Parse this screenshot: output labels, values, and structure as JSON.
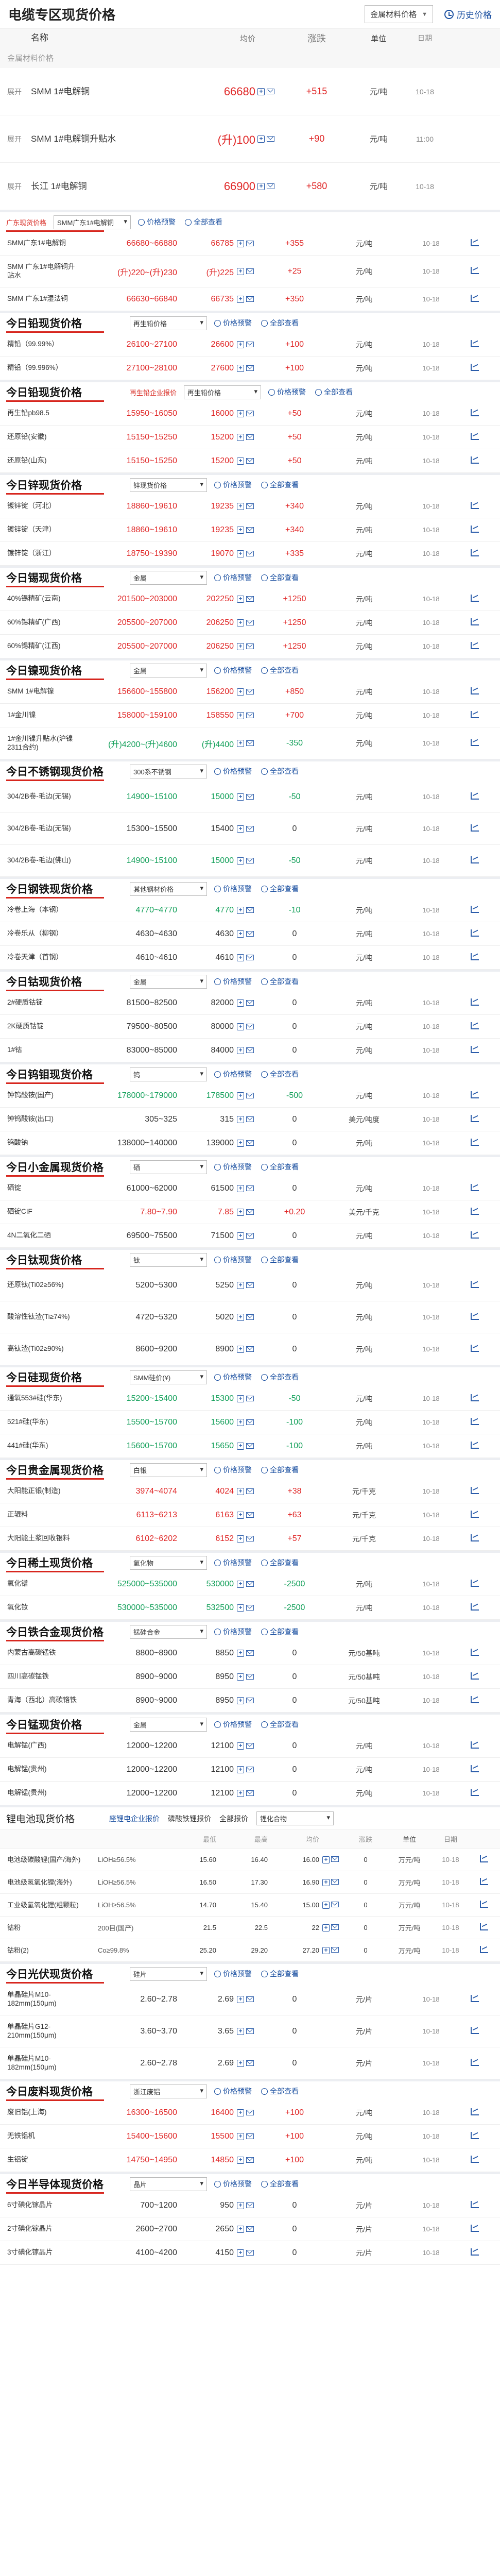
{
  "header": {
    "title": "电缆专区现货价格",
    "select_value": "金属材料价格",
    "history_label": "历史价格"
  },
  "columns": {
    "name": "名称",
    "avg": "均价",
    "chg": "涨跌",
    "unit": "单位",
    "date": "日期"
  },
  "group_label": "金属材料价格",
  "expand_label": "展开",
  "top_rows": [
    {
      "name": "SMM 1#电解铜",
      "avg": "66680",
      "chg": "+515",
      "unit": "元/吨",
      "date": "10-18",
      "dir": "up"
    },
    {
      "name": "SMM 1#电解铜升贴水",
      "avg": "(升)100",
      "chg": "+90",
      "unit": "元/吨",
      "date": "11:00",
      "dir": "up"
    },
    {
      "name": "长江 1#电解铜",
      "avg": "66900",
      "chg": "+580",
      "unit": "元/吨",
      "date": "10-18",
      "dir": "up"
    }
  ],
  "sections": [
    {
      "key": "copper",
      "title": "",
      "rows": [
        {
          "name": "SMM广东1#电解铜",
          "range": "66680~66880",
          "avg": "66785",
          "chg": "+355",
          "unit": "元/吨",
          "date": "10-18",
          "dir": "up"
        },
        {
          "name": "SMM 广东1#电解铜升贴水",
          "range": "(升)220~(升)230",
          "avg": "(升)225",
          "chg": "+25",
          "unit": "元/吨",
          "date": "10-18",
          "dir": "up"
        },
        {
          "name": "SMM 广东1#湿法铜",
          "range": "66630~66840",
          "avg": "66735",
          "chg": "+350",
          "unit": "元/吨",
          "date": "10-18",
          "dir": "up"
        }
      ],
      "tag": "SMM广东1#电解铜",
      "highlight": "广东现货价格"
    },
    {
      "key": "lead",
      "title": "今日铅现货价格",
      "select": "再生铅价格",
      "rows": [
        {
          "name": "精铅（99.99%）",
          "range": "26100~27100",
          "avg": "26600",
          "chg": "+100",
          "unit": "元/吨",
          "date": "10-18",
          "dir": "up"
        },
        {
          "name": "精铅（99.996%）",
          "range": "27100~28100",
          "avg": "27600",
          "chg": "+100",
          "unit": "元/吨",
          "date": "10-18",
          "dir": "up"
        }
      ]
    },
    {
      "key": "recycled-lead",
      "title": "今日铅现货价格",
      "select": "再生铅价格",
      "highlight": "再生铅企业报价",
      "rows": [
        {
          "name": "再生铅pb98.5",
          "range": "15950~16050",
          "avg": "16000",
          "chg": "+50",
          "unit": "元/吨",
          "date": "10-18",
          "dir": "up"
        },
        {
          "name": "还原铅(安徽)",
          "range": "15150~15250",
          "avg": "15200",
          "chg": "+50",
          "unit": "元/吨",
          "date": "10-18",
          "dir": "up"
        },
        {
          "name": "还原铅(山东)",
          "range": "15150~15250",
          "avg": "15200",
          "chg": "+50",
          "unit": "元/吨",
          "date": "10-18",
          "dir": "up"
        }
      ]
    },
    {
      "key": "zinc",
      "title": "今日锌现货价格",
      "select": "锌现货价格",
      "rows": [
        {
          "name": "镀锌锭（河北）",
          "range": "18860~19610",
          "avg": "19235",
          "chg": "+340",
          "unit": "元/吨",
          "date": "10-18",
          "dir": "up"
        },
        {
          "name": "镀锌锭（天津）",
          "range": "18860~19610",
          "avg": "19235",
          "chg": "+340",
          "unit": "元/吨",
          "date": "10-18",
          "dir": "up"
        },
        {
          "name": "镀锌锭（浙江）",
          "range": "18750~19390",
          "avg": "19070",
          "chg": "+335",
          "unit": "元/吨",
          "date": "10-18",
          "dir": "up"
        }
      ]
    },
    {
      "key": "tin",
      "title": "今日锡现货价格",
      "select": "金属",
      "rows": [
        {
          "name": "40%锡精矿(云南)",
          "range": "201500~203000",
          "avg": "202250",
          "chg": "+1250",
          "unit": "元/吨",
          "date": "10-18",
          "dir": "up"
        },
        {
          "name": "60%锡精矿(广西)",
          "range": "205500~207000",
          "avg": "206250",
          "chg": "+1250",
          "unit": "元/吨",
          "date": "10-18",
          "dir": "up"
        },
        {
          "name": "60%锡精矿(江西)",
          "range": "205500~207000",
          "avg": "206250",
          "chg": "+1250",
          "unit": "元/吨",
          "date": "10-18",
          "dir": "up"
        }
      ]
    },
    {
      "key": "nickel",
      "title": "今日镍现货价格",
      "select": "金属",
      "rows": [
        {
          "name": "SMM 1#电解镍",
          "range": "156600~155800",
          "avg": "156200",
          "chg": "+850",
          "unit": "元/吨",
          "date": "10-18",
          "dir": "up"
        },
        {
          "name": "1#金川镍",
          "range": "158000~159100",
          "avg": "158550",
          "chg": "+700",
          "unit": "元/吨",
          "date": "10-18",
          "dir": "up"
        },
        {
          "name": "1#金川镍升贴水(沪镍2311合约)",
          "range": "(升)4200~(升)4600",
          "avg": "(升)4400",
          "chg": "-350",
          "unit": "元/吨",
          "date": "10-18",
          "dir": "down"
        }
      ]
    },
    {
      "key": "stainless",
      "title": "今日不锈钢现货价格",
      "select": "300系不锈钢",
      "rows": [
        {
          "name": "304/2B卷-毛边(无锡)",
          "range": "14900~15100",
          "avg": "15000",
          "chg": "-50",
          "unit": "元/吨",
          "date": "10-18",
          "dir": "down"
        },
        {
          "name": "304/2B卷-毛边(无锡)",
          "range": "15300~15500",
          "avg": "15400",
          "chg": "0",
          "unit": "元/吨",
          "date": "10-18",
          "dir": "flat"
        },
        {
          "name": "304/2B卷-毛边(佛山)",
          "range": "14900~15100",
          "avg": "15000",
          "chg": "-50",
          "unit": "元/吨",
          "date": "10-18",
          "dir": "down"
        }
      ]
    },
    {
      "key": "steel",
      "title": "今日钢铁现货价格",
      "select": "其他钢材价格",
      "rows": [
        {
          "name": "冷卷上海（本钢）",
          "range": "4770~4770",
          "avg": "4770",
          "chg": "-10",
          "unit": "元/吨",
          "date": "10-18",
          "dir": "down"
        },
        {
          "name": "冷卷乐从（柳钢）",
          "range": "4630~4630",
          "avg": "4630",
          "chg": "0",
          "unit": "元/吨",
          "date": "10-18",
          "dir": "flat"
        },
        {
          "name": "冷卷天津（首钢）",
          "range": "4610~4610",
          "avg": "4610",
          "chg": "0",
          "unit": "元/吨",
          "date": "10-18",
          "dir": "flat"
        }
      ]
    },
    {
      "key": "cobalt",
      "title": "今日钴现货价格",
      "select": "金属",
      "rows": [
        {
          "name": "2#硬质钴锭",
          "range": "81500~82500",
          "avg": "82000",
          "chg": "0",
          "unit": "元/吨",
          "date": "10-18",
          "dir": "flat"
        },
        {
          "name": "2K硬质钴锭",
          "range": "79500~80500",
          "avg": "80000",
          "chg": "0",
          "unit": "元/吨",
          "date": "10-18",
          "dir": "flat"
        },
        {
          "name": "1#钴",
          "range": "83000~85000",
          "avg": "84000",
          "chg": "0",
          "unit": "元/吨",
          "date": "10-18",
          "dir": "flat"
        }
      ]
    },
    {
      "key": "tungsten",
      "title": "今日钨钼现货价格",
      "select": "钨",
      "rows": [
        {
          "name": "钟钨酸铵(国产)",
          "range": "178000~179000",
          "avg": "178500",
          "chg": "-500",
          "unit": "元/吨",
          "date": "10-18",
          "dir": "down"
        },
        {
          "name": "钟钨酸铵(出口)",
          "range": "305~325",
          "avg": "315",
          "chg": "0",
          "unit": "美元/吨度",
          "date": "10-18",
          "dir": "flat"
        },
        {
          "name": "钨酸钠",
          "range": "138000~140000",
          "avg": "139000",
          "chg": "0",
          "unit": "元/吨",
          "date": "10-18",
          "dir": "flat"
        }
      ]
    },
    {
      "key": "minor",
      "title": "今日小金属现货价格",
      "select": "硒",
      "rows": [
        {
          "name": "硒锭",
          "range": "61000~62000",
          "avg": "61500",
          "chg": "0",
          "unit": "元/吨",
          "date": "10-18",
          "dir": "flat"
        },
        {
          "name": "硒锭CIF",
          "range": "7.80~7.90",
          "avg": "7.85",
          "chg": "+0.20",
          "unit": "美元/千克",
          "date": "10-18",
          "dir": "up"
        },
        {
          "name": "4N二氧化二硒",
          "range": "69500~75500",
          "avg": "71500",
          "chg": "0",
          "unit": "元/吨",
          "date": "10-18",
          "dir": "flat"
        }
      ]
    },
    {
      "key": "titanium",
      "title": "今日钛现货价格",
      "select": "钛",
      "rows": [
        {
          "name": "还原钛(Ti02≥56%)",
          "range": "5200~5300",
          "avg": "5250",
          "chg": "0",
          "unit": "元/吨",
          "date": "10-18",
          "dir": "flat"
        },
        {
          "name": "酸溶性钛渣(Ti≥74%)",
          "range": "4720~5320",
          "avg": "5020",
          "chg": "0",
          "unit": "元/吨",
          "date": "10-18",
          "dir": "flat"
        },
        {
          "name": "高钛渣(Ti02≥90%)",
          "range": "8600~9200",
          "avg": "8900",
          "chg": "0",
          "unit": "元/吨",
          "date": "10-18",
          "dir": "flat"
        }
      ]
    },
    {
      "key": "silicon",
      "title": "今日硅现货价格",
      "select": "SMM硅价(¥)",
      "rows": [
        {
          "name": "通氧553#硅(华东)",
          "range": "15200~15400",
          "avg": "15300",
          "chg": "-50",
          "unit": "元/吨",
          "date": "10-18",
          "dir": "down"
        },
        {
          "name": "521#硅(华东)",
          "range": "15500~15700",
          "avg": "15600",
          "chg": "-100",
          "unit": "元/吨",
          "date": "10-18",
          "dir": "down"
        },
        {
          "name": "441#硅(华东)",
          "range": "15600~15700",
          "avg": "15650",
          "chg": "-100",
          "unit": "元/吨",
          "date": "10-18",
          "dir": "down"
        }
      ]
    },
    {
      "key": "precious",
      "title": "今日贵金属现货价格",
      "select": "白银",
      "rows": [
        {
          "name": "大阳能正银(制造)",
          "range": "3974~4074",
          "avg": "4024",
          "chg": "+38",
          "unit": "元/千克",
          "date": "10-18",
          "dir": "up"
        },
        {
          "name": "正辊料",
          "range": "6113~6213",
          "avg": "6163",
          "chg": "+63",
          "unit": "元/千克",
          "date": "10-18",
          "dir": "up"
        },
        {
          "name": "大阳能土浆回收银料",
          "range": "6102~6202",
          "avg": "6152",
          "chg": "+57",
          "unit": "元/千克",
          "date": "10-18",
          "dir": "up"
        }
      ]
    },
    {
      "key": "rare-earth",
      "title": "今日稀土现货价格",
      "select": "氧化物",
      "rows": [
        {
          "name": "氧化镨",
          "range": "525000~535000",
          "avg": "530000",
          "chg": "-2500",
          "unit": "元/吨",
          "date": "10-18",
          "dir": "down"
        },
        {
          "name": "氧化钕",
          "range": "530000~535000",
          "avg": "532500",
          "chg": "-2500",
          "unit": "元/吨",
          "date": "10-18",
          "dir": "down"
        }
      ]
    },
    {
      "key": "ferroalloy",
      "title": "今日铁合金现货价格",
      "select": "锰硅合金",
      "rows": [
        {
          "name": "内蒙古高碳锰铁",
          "range": "8800~8900",
          "avg": "8850",
          "chg": "0",
          "unit": "元/50基吨",
          "date": "10-18",
          "dir": "flat"
        },
        {
          "name": "四川高碳锰铁",
          "range": "8900~9000",
          "avg": "8950",
          "chg": "0",
          "unit": "元/50基吨",
          "date": "10-18",
          "dir": "flat"
        },
        {
          "name": "青海（西北）高碳铬铁",
          "range": "8900~9000",
          "avg": "8950",
          "chg": "0",
          "unit": "元/50基吨",
          "date": "10-18",
          "dir": "flat"
        }
      ]
    },
    {
      "key": "manganese",
      "title": "今日锰现货价格",
      "select": "金属",
      "rows": [
        {
          "name": "电解锰(广西)",
          "range": "12000~12200",
          "avg": "12100",
          "chg": "0",
          "unit": "元/吨",
          "date": "10-18",
          "dir": "flat"
        },
        {
          "name": "电解锰(贵州)",
          "range": "12000~12200",
          "avg": "12100",
          "chg": "0",
          "unit": "元/吨",
          "date": "10-18",
          "dir": "flat"
        },
        {
          "name": "电解锰(贵州)",
          "range": "12000~12200",
          "avg": "12100",
          "chg": "0",
          "unit": "元/吨",
          "date": "10-18",
          "dir": "flat"
        }
      ]
    }
  ],
  "lithium": {
    "title": "锂电池现货价格",
    "tabs": [
      "座锂电企业报价",
      "磷酸铁锂报价",
      "全部报价"
    ],
    "select": "锂化合物",
    "columns": [
      "",
      "",
      "最低",
      "最高",
      "均价",
      "",
      "涨跌",
      "单位",
      "日期"
    ],
    "rows": [
      {
        "name": "电池级碳酸锂(国产/海外)",
        "spec": "LiOH≥56.5%",
        "low": "15.60",
        "high": "16.40",
        "avg": "16.00",
        "chg": "0",
        "unit": "万元/吨",
        "date": "10-18"
      },
      {
        "name": "电池级氢氧化锂(海外)",
        "spec": "LiOH≥56.5%",
        "low": "16.50",
        "high": "17.30",
        "avg": "16.90",
        "chg": "0",
        "unit": "万元/吨",
        "date": "10-18"
      },
      {
        "name": "工业级氢氧化锂(粗颗粒)",
        "spec": "LiOH≥56.5%",
        "low": "14.70",
        "high": "15.40",
        "avg": "15.00",
        "chg": "0",
        "unit": "万元/吨",
        "date": "10-18"
      },
      {
        "name": "钴粉",
        "spec": "200目(国产)",
        "low": "21.5",
        "high": "22.5",
        "avg": "22",
        "chg": "0",
        "unit": "万元/吨",
        "date": "10-18"
      },
      {
        "name": "钴粉(2)",
        "spec": "Co≥99.8%",
        "low": "25.20",
        "high": "29.20",
        "avg": "27.20",
        "chg": "0",
        "unit": "万元/吨",
        "date": "10-18"
      }
    ]
  },
  "sections2": [
    {
      "key": "solar",
      "title": "今日光伏现货价格",
      "select": "硅片",
      "rows": [
        {
          "name": "单晶硅片M10-182mm(150μm)",
          "range": "2.60~2.78",
          "avg": "2.69",
          "chg": "0",
          "unit": "元/片",
          "date": "10-18",
          "dir": "flat"
        },
        {
          "name": "单晶硅片G12-210mm(150μm)",
          "range": "3.60~3.70",
          "avg": "3.65",
          "chg": "0",
          "unit": "元/片",
          "date": "10-18",
          "dir": "flat"
        },
        {
          "name": "单晶硅片M10-182mm(150μm)",
          "range": "2.60~2.78",
          "avg": "2.69",
          "chg": "0",
          "unit": "元/片",
          "date": "10-18",
          "dir": "flat"
        }
      ]
    },
    {
      "key": "scrap",
      "title": "今日废料现货价格",
      "select": "浙江废铝",
      "rows": [
        {
          "name": "废旧铝(上海)",
          "range": "16300~16500",
          "avg": "16400",
          "chg": "+100",
          "unit": "元/吨",
          "date": "10-18",
          "dir": "up"
        },
        {
          "name": "无铁铝机",
          "range": "15400~15600",
          "avg": "15500",
          "chg": "+100",
          "unit": "元/吨",
          "date": "10-18",
          "dir": "up"
        },
        {
          "name": "生铝锭",
          "range": "14750~14950",
          "avg": "14850",
          "chg": "+100",
          "unit": "元/吨",
          "date": "10-18",
          "dir": "up"
        }
      ]
    },
    {
      "key": "semiconductor",
      "title": "今日半导体现货价格",
      "select": "晶片",
      "rows": [
        {
          "name": "6寸碘化镓晶片",
          "range": "700~1200",
          "avg": "950",
          "chg": "0",
          "unit": "元/片",
          "date": "10-18",
          "dir": "flat"
        },
        {
          "name": "2寸碘化镓晶片",
          "range": "2600~2700",
          "avg": "2650",
          "chg": "0",
          "unit": "元/片",
          "date": "10-18",
          "dir": "flat"
        },
        {
          "name": "3寸碘化镓晶片",
          "range": "4100~4200",
          "avg": "4150",
          "chg": "0",
          "unit": "元/片",
          "date": "10-18",
          "dir": "flat"
        }
      ]
    }
  ],
  "common": {
    "alert_label": "价格预警",
    "history_label": "全部查看"
  },
  "colors": {
    "up": "#e02828",
    "down": "#13a05a",
    "flat": "#333333",
    "accent": "#d7261e",
    "link": "#1a4fa0"
  }
}
